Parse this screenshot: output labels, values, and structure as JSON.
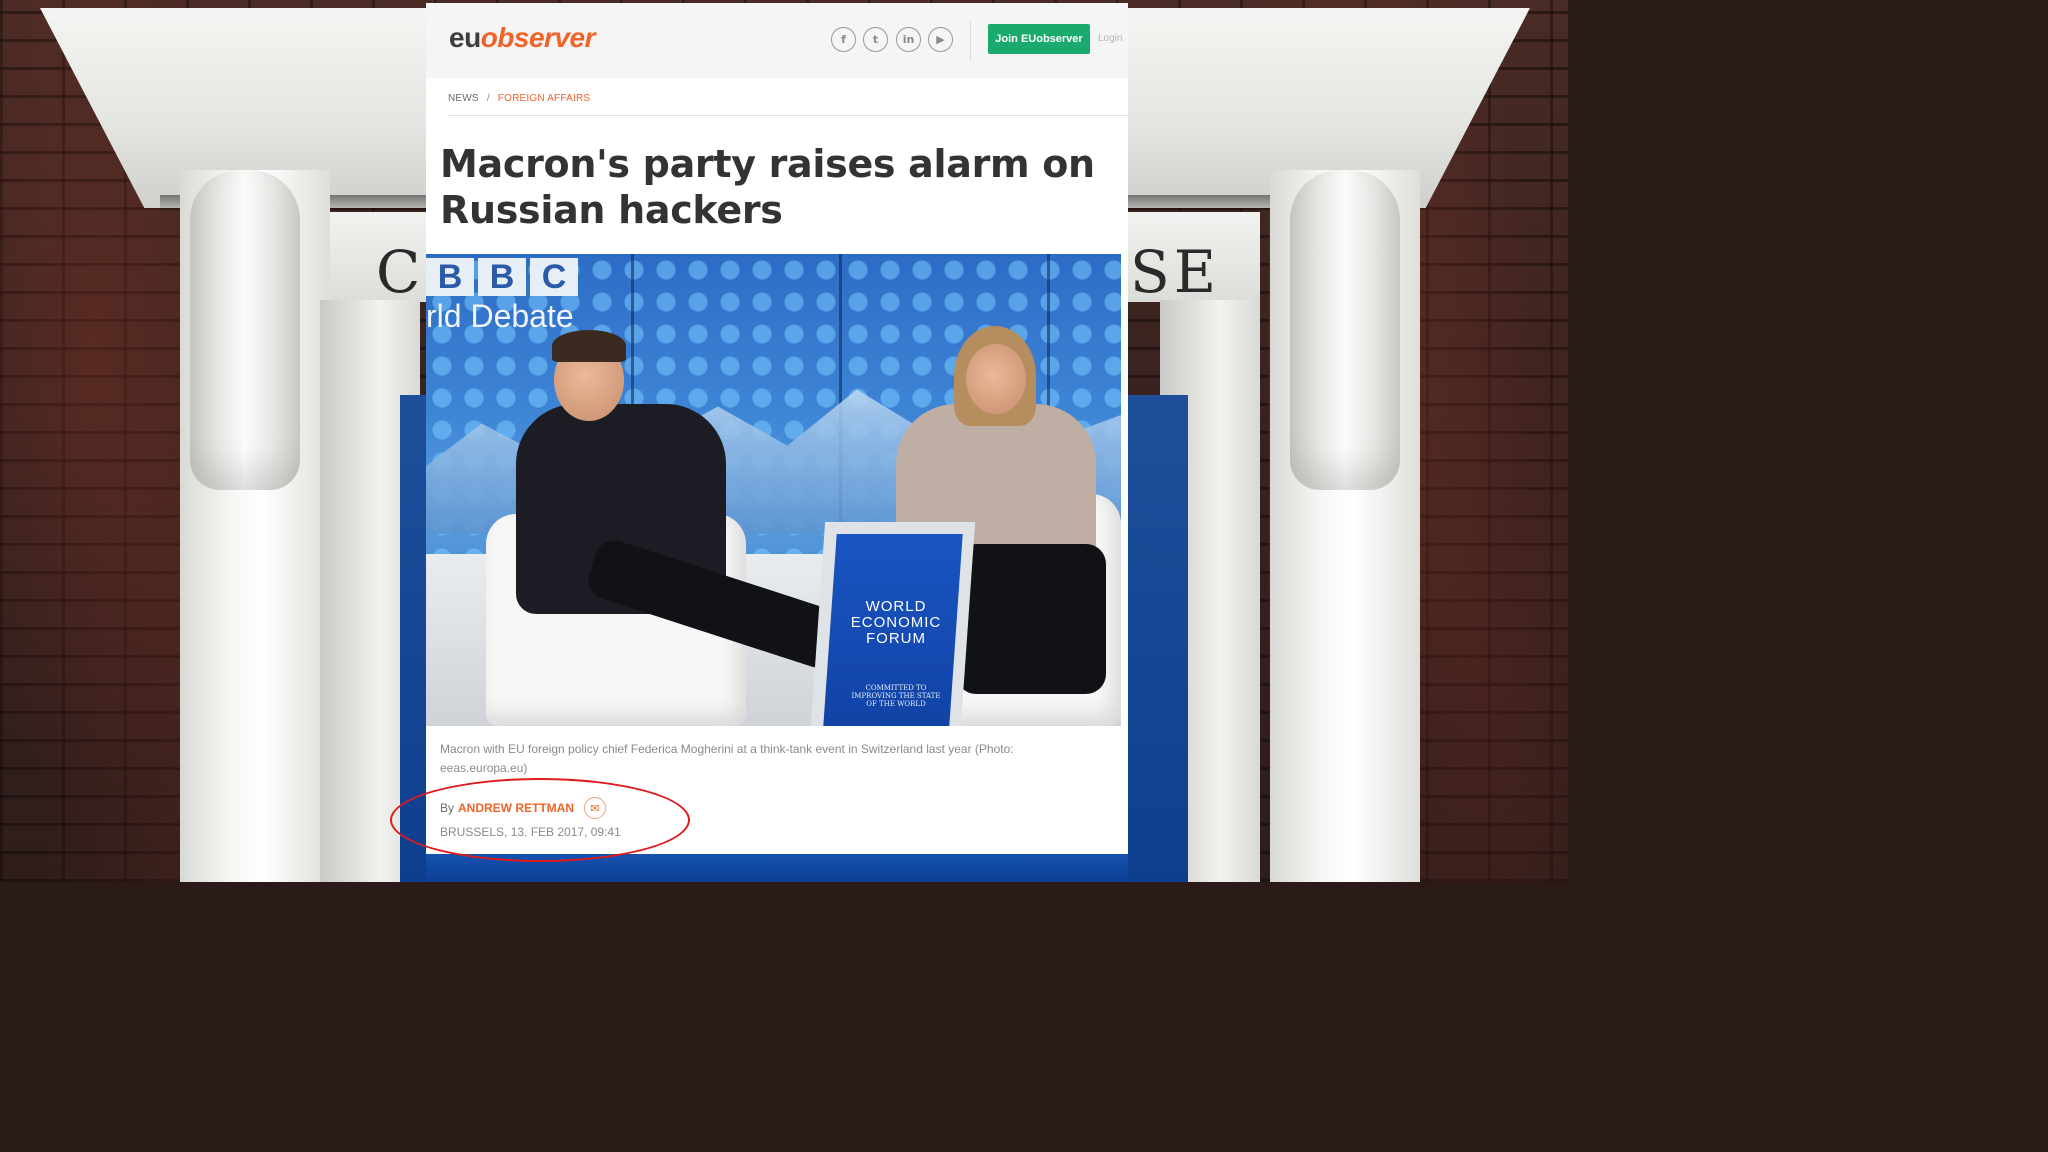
{
  "background": {
    "frieze_letters_left": "C",
    "frieze_letters_right": "SE"
  },
  "site": {
    "logo_prefix": "eu",
    "logo_suffix": "observer",
    "social_icons": [
      "facebook-icon",
      "twitter-icon",
      "linkedin-icon",
      "youtube-icon"
    ],
    "join_label": "Join EUobserver",
    "login_label": "Login",
    "accent_color": "#f0642a",
    "join_color": "#1aaa6e"
  },
  "breadcrumb": {
    "section": "NEWS",
    "separator": "/",
    "category": "FOREIGN AFFAIRS"
  },
  "article": {
    "headline": "Macron's party raises alarm on Russian hackers",
    "photo": {
      "bbc_letters": [
        "B",
        "B",
        "C"
      ],
      "screen_text": "rld Debate",
      "podium_text": "WORLD ECONOMIC FORUM",
      "podium_subtext": "COMMITTED TO IMPROVING THE STATE OF THE WORLD"
    },
    "caption": "Macron with EU foreign policy chief Federica Mogherini at a think-tank event in Switzerland last year (Photo: eeas.europa.eu)",
    "byline_prefix": "By",
    "author": "ANDREW RETTMAN",
    "dateline": "BRUSSELS, 13. FEB 2017, 09:41"
  },
  "annotation": {
    "color": "#e01a1a",
    "shape": "ellipse"
  }
}
